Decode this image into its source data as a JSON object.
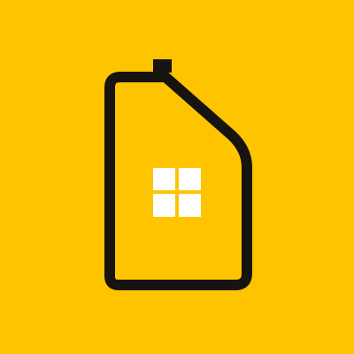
{
  "logo": {
    "background_color": "#FFC400",
    "outline_color": "#161311",
    "window_color": "#FFFFFF",
    "icon": "house-bottle-logo"
  }
}
